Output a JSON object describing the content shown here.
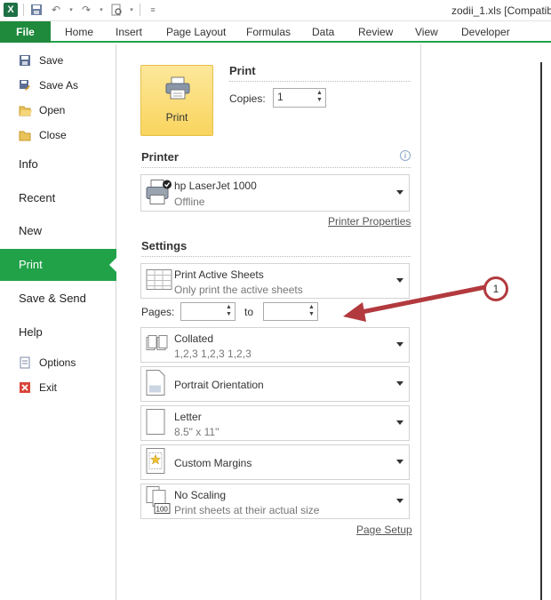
{
  "app": {
    "window_title": "zodii_1.xls  [Compatib"
  },
  "ribbon": {
    "file": "File",
    "tabs": [
      "Home",
      "Insert",
      "Page Layout",
      "Formulas",
      "Data",
      "Review",
      "View",
      "Developer"
    ]
  },
  "nav": {
    "save": "Save",
    "save_as": "Save As",
    "open": "Open",
    "close": "Close",
    "info": "Info",
    "recent": "Recent",
    "new": "New",
    "print": "Print",
    "save_send": "Save & Send",
    "help": "Help",
    "options": "Options",
    "exit": "Exit"
  },
  "print": {
    "heading": "Print",
    "button_label": "Print",
    "copies_label": "Copies:",
    "copies_value": "1"
  },
  "printer": {
    "heading": "Printer",
    "name": "hp LaserJet 1000",
    "status": "Offline",
    "properties_link": "Printer Properties"
  },
  "settings": {
    "heading": "Settings",
    "active_sheets": {
      "title": "Print Active Sheets",
      "subtitle": "Only print the active sheets"
    },
    "pages_label": "Pages:",
    "to_label": "to",
    "collated": {
      "title": "Collated",
      "subtitle": "1,2,3    1,2,3    1,2,3"
    },
    "orientation": {
      "title": "Portrait Orientation"
    },
    "paper": {
      "title": "Letter",
      "subtitle": "8.5\" x 11\""
    },
    "margins": {
      "title": "Custom Margins"
    },
    "scaling": {
      "title": "No Scaling",
      "subtitle": "Print sheets at their actual size",
      "badge": "100"
    },
    "page_setup_link": "Page Setup"
  },
  "annotation": {
    "callout_number": "1",
    "color": "#b23a3e"
  },
  "colors": {
    "accent_green": "#21a249",
    "file_tab": "#1f8a3c"
  }
}
